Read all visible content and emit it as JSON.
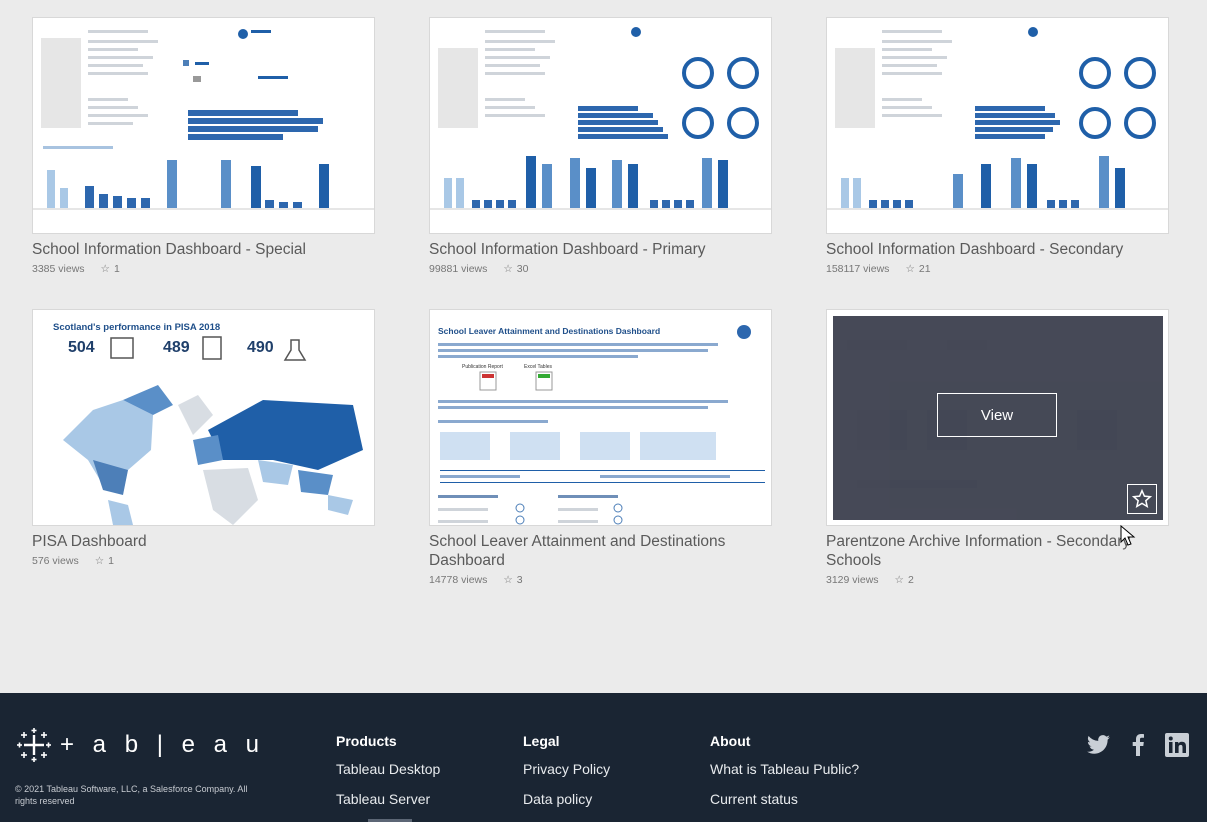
{
  "cards": [
    {
      "title": "School Information Dashboard - Special",
      "views": "3385 views",
      "favorites": "1"
    },
    {
      "title": "School Information Dashboard - Primary",
      "views": "99881 views",
      "favorites": "30"
    },
    {
      "title": "School Information Dashboard - Secondary",
      "views": "158117 views",
      "favorites": "21"
    },
    {
      "title": "PISA Dashboard",
      "views": "576 views",
      "favorites": "1"
    },
    {
      "title": "School Leaver Attainment and Destinations Dashboard",
      "views": "14778 views",
      "favorites": "3"
    },
    {
      "title": "Parentzone Archive Information - Secondary Schools",
      "views": "3129 views",
      "favorites": "2",
      "hover_button": "View"
    }
  ],
  "thumbnails": {
    "pisa": {
      "heading": "Scotland's performance in PISA 2018",
      "scores": [
        "504",
        "489",
        "490"
      ]
    },
    "leaver": {
      "heading": "School Leaver Attainment and Destinations Dashboard",
      "buttons": [
        "Publication Report",
        "Excel Tables"
      ]
    }
  },
  "footer": {
    "logo_text": "+ a b | e a u",
    "copyright": "© 2021 Tableau Software, LLC, a Salesforce Company. All rights reserved",
    "products": {
      "heading": "Products",
      "links": [
        "Tableau Desktop",
        "Tableau Server"
      ]
    },
    "legal": {
      "heading": "Legal",
      "links": [
        "Privacy Policy",
        "Data policy"
      ]
    },
    "about": {
      "heading": "About",
      "links": [
        "What is Tableau Public?",
        "Current status"
      ]
    }
  },
  "colors": {
    "dark_blue": "#1f5fa8",
    "mid_blue": "#5a8fc8",
    "light_blue": "#a9c8e6",
    "footer_bg": "#1a2533"
  }
}
